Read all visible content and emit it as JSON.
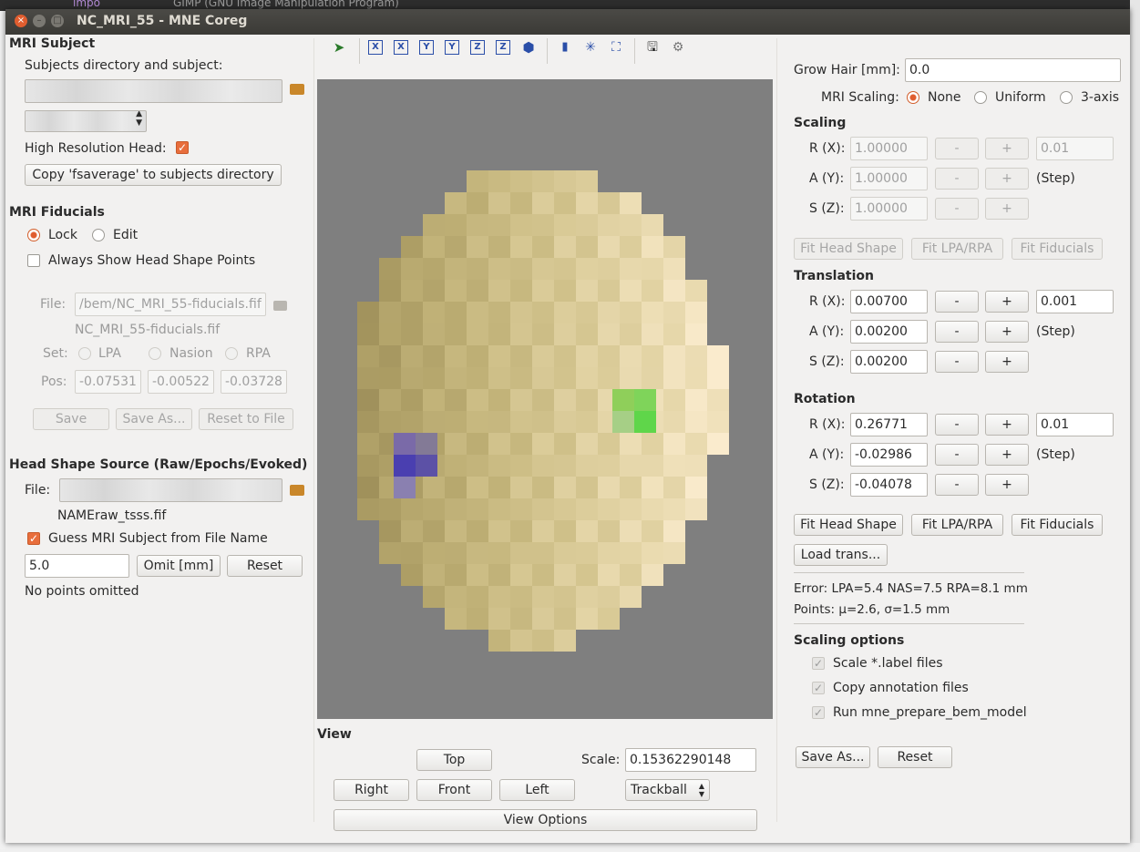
{
  "background": {
    "top_text": "GIMP (GNU Image Manipulation Program)",
    "top_code": "impo"
  },
  "window": {
    "title": "NC_MRI_55 - MNE Coreg",
    "close_glyph": "×",
    "min_glyph": "–",
    "max_glyph": "□"
  },
  "mri_subject": {
    "section": "MRI Subject",
    "dir_label": "Subjects directory and subject:",
    "high_res_label": "High Resolution Head:",
    "copy_button": "Copy 'fsaverage' to subjects directory"
  },
  "mri_fiducials": {
    "section": "MRI Fiducials",
    "lock": "Lock",
    "edit": "Edit",
    "always_show": "Always Show Head Shape Points",
    "file_label": "File:",
    "file_value": "/bem/NC_MRI_55-fiducials.fif",
    "file_name": "NC_MRI_55-fiducials.fif",
    "set_label": "Set:",
    "set_options": [
      "LPA",
      "Nasion",
      "RPA"
    ],
    "pos_label": "Pos:",
    "pos": [
      "-0.07531",
      "-0.00522",
      "-0.03728"
    ],
    "save": "Save",
    "save_as": "Save As...",
    "reset_to_file": "Reset to File"
  },
  "head_shape": {
    "section": "Head Shape Source (Raw/Epochs/Evoked)",
    "file_label": "File:",
    "file_name": "NAMEraw_tsss.fif",
    "guess_label": "Guess MRI Subject from File Name",
    "omit_value": "5.0",
    "omit_button": "Omit [mm]",
    "reset_button": "Reset",
    "status": "No points omitted"
  },
  "view": {
    "label": "View",
    "top": "Top",
    "right": "Right",
    "front": "Front",
    "left": "Left",
    "scale_label": "Scale:",
    "scale_value": "0.15362290148",
    "mode": "Trackball",
    "view_options": "View Options",
    "toolbar_axes": [
      "X",
      "X",
      "Y",
      "Y",
      "Z",
      "Z"
    ]
  },
  "right": {
    "grow_hair_label": "Grow Hair [mm]:",
    "grow_hair_value": "0.0",
    "mri_scaling_label": "MRI Scaling:",
    "scaling_modes": [
      "None",
      "Uniform",
      "3-axis"
    ],
    "scaling_section": "Scaling",
    "scaling_rows": [
      {
        "label": "R (X):",
        "value": "1.00000"
      },
      {
        "label": "A (Y):",
        "value": "1.00000"
      },
      {
        "label": "S (Z):",
        "value": "1.00000"
      }
    ],
    "scaling_step": "0.01",
    "step_label": "(Step)",
    "minus": "-",
    "plus": "+",
    "fit_head_shape": "Fit Head Shape",
    "fit_lpa_rpa": "Fit LPA/RPA",
    "fit_fiducials": "Fit Fiducials",
    "translation_section": "Translation",
    "translation_rows": [
      {
        "label": "R (X):",
        "value": "0.00700"
      },
      {
        "label": "A (Y):",
        "value": "0.00200"
      },
      {
        "label": "S (Z):",
        "value": "0.00200"
      }
    ],
    "translation_step": "0.001",
    "rotation_section": "Rotation",
    "rotation_rows": [
      {
        "label": "R (X):",
        "value": "0.26771"
      },
      {
        "label": "A (Y):",
        "value": "-0.02986"
      },
      {
        "label": "S (Z):",
        "value": "-0.04078"
      }
    ],
    "rotation_step": "0.01",
    "load_trans": "Load trans...",
    "error_text": "Error: LPA=5.4 NAS=7.5 RPA=8.1 mm",
    "points_text": "Points: μ=2.6, σ=1.5 mm",
    "scaling_options_section": "Scaling options",
    "scale_label_files": "Scale *.label files",
    "copy_annotation": "Copy annotation files",
    "run_prepare": "Run mne_prepare_bem_model",
    "save_as": "Save As...",
    "reset": "Reset"
  },
  "colors": {
    "accent": "#e05d2f",
    "view_bg": "#7f7f7f"
  }
}
